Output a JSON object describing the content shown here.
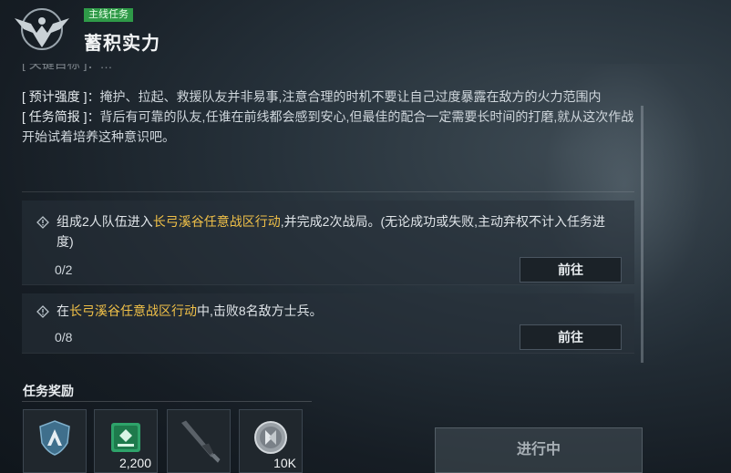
{
  "header": {
    "tag": "主线任务",
    "title": "蓄积实力"
  },
  "description": {
    "cut_line": "[ 关键目标 ]：…",
    "intensity_key": "[ 预计强度 ]",
    "intensity_text": "：掩护、拉起、救援队友并非易事,注意合理的时机不要让自己过度暴露在敌方的火力范围内",
    "brief_key": "[ 任务简报 ]",
    "brief_text": "：背后有可靠的队友,任谁在前线都会感到安心,但最佳的配合一定需要长时间的打磨,就从这次作战开始试着培养这种意识吧。"
  },
  "tasks": [
    {
      "pre": "组成2人队伍进入",
      "highlight": "长弓溪谷任意战区行动",
      "post": ",并完成2次战局。(无论成功或失败,主动弃权不计入任务进度)",
      "progress": "0/2",
      "button": "前往"
    },
    {
      "pre": "在",
      "highlight": "长弓溪谷任意战区行动",
      "post": "中,击败8名敌方士兵。",
      "progress": "0/8",
      "button": "前往"
    }
  ],
  "rewards": {
    "title": "任务奖励",
    "items": [
      {
        "icon": "shield-emblem-icon",
        "count": ""
      },
      {
        "icon": "supply-crate-icon",
        "count": "2,200"
      },
      {
        "icon": "rifle-icon",
        "count": ""
      },
      {
        "icon": "coin-icon",
        "count": "10K"
      }
    ]
  },
  "status_button": "进行中",
  "colors": {
    "tag_green": "#2f9a48",
    "highlight_gold": "#f0c048",
    "crate_green": "#2ea36a"
  }
}
